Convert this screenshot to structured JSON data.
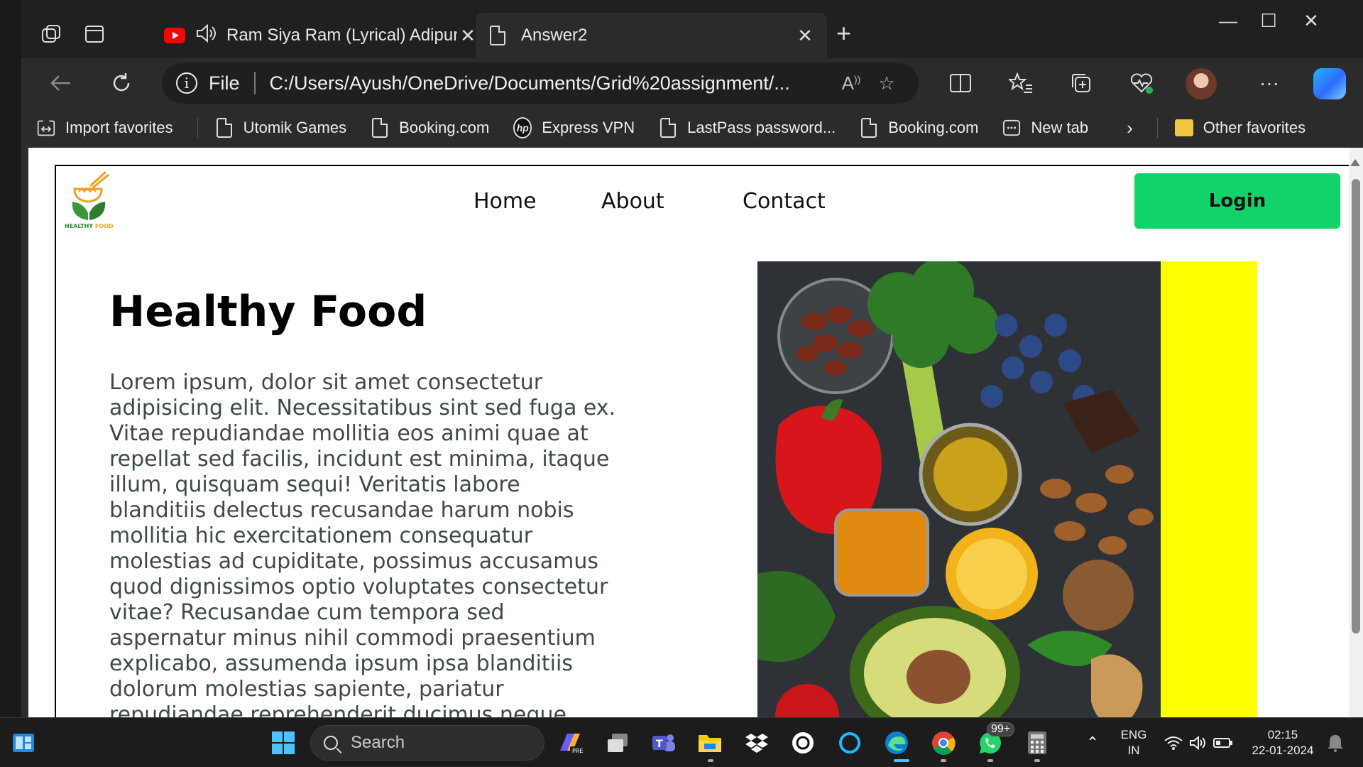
{
  "browser": {
    "tabs": [
      {
        "title": "Ram Siya Ram (Lyrical) Adipurush",
        "active": false,
        "audio": true
      },
      {
        "title": "Answer2",
        "active": true
      }
    ],
    "address": {
      "scheme": "File",
      "url": "C:/Users/Ayush/OneDrive/Documents/Grid%20assignment/..."
    },
    "favorites": [
      {
        "label": "Import favorites",
        "icon": "import-icon"
      },
      {
        "label": "Utomik Games",
        "icon": "page-icon"
      },
      {
        "label": "Booking.com",
        "icon": "page-icon"
      },
      {
        "label": "Express VPN",
        "icon": "hp-icon"
      },
      {
        "label": "LastPass password...",
        "icon": "page-icon"
      },
      {
        "label": "Booking.com",
        "icon": "page-icon"
      },
      {
        "label": "New tab",
        "icon": "newtab-icon"
      }
    ],
    "other_favorites": "Other favorites"
  },
  "site": {
    "logo_text_1": "HEALTHY ",
    "logo_text_2": "FOOD",
    "nav": [
      "Home",
      "About",
      "Contact"
    ],
    "login_label": "Login",
    "hero_title": "Healthy Food",
    "hero_text": "Lorem ipsum, dolor sit amet consectetur adipisicing elit. Necessitatibus sint sed fuga ex. Vitae repudiandae mollitia eos animi quae at repellat sed facilis, incidunt est minima, itaque illum, quisquam sequi! Veritatis labore blanditiis delectus recusandae harum nobis mollitia hic exercitationem consequatur molestias ad cupiditate, possimus accusamus quod dignissimos optio voluptates consectetur vitae? Recusandae cum tempora sed aspernatur minus nihil commodi praesentium explicabo, assumenda ipsum ipsa blanditiis dolorum molestias sapiente, pariatur repudiandae reprehenderit ducimus neque, nesciunt possimus et corrupti maiores voluptas.",
    "accent_color": "#12d36a",
    "side_block_color": "#ffff00"
  },
  "taskbar": {
    "search_placeholder": "Search",
    "whatsapp_badge": "99+",
    "lang_1": "ENG",
    "lang_2": "IN",
    "time": "02:15",
    "date": "22-01-2024"
  }
}
